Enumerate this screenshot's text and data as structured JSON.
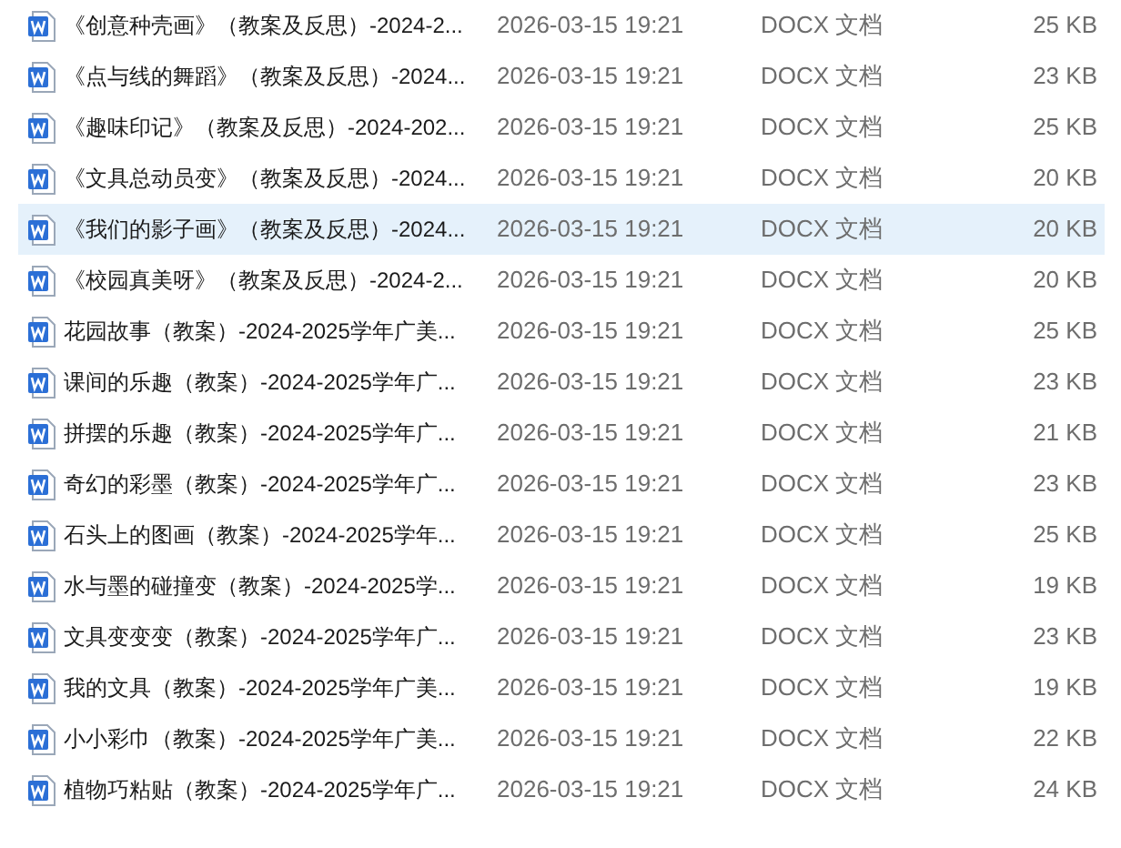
{
  "files": [
    {
      "name": "《创意种壳画》（教案及反思）-2024-2...",
      "modified": "2026-03-15 19:21",
      "type": "DOCX 文档",
      "size": "25 KB",
      "selected": false
    },
    {
      "name": "《点与线的舞蹈》（教案及反思）-2024...",
      "modified": "2026-03-15 19:21",
      "type": "DOCX 文档",
      "size": "23 KB",
      "selected": false
    },
    {
      "name": "《趣味印记》（教案及反思）-2024-202...",
      "modified": "2026-03-15 19:21",
      "type": "DOCX 文档",
      "size": "25 KB",
      "selected": false
    },
    {
      "name": "《文具总动员变》（教案及反思）-2024...",
      "modified": "2026-03-15 19:21",
      "type": "DOCX 文档",
      "size": "20 KB",
      "selected": false
    },
    {
      "name": "《我们的影子画》（教案及反思）-2024...",
      "modified": "2026-03-15 19:21",
      "type": "DOCX 文档",
      "size": "20 KB",
      "selected": true
    },
    {
      "name": "《校园真美呀》（教案及反思）-2024-2...",
      "modified": "2026-03-15 19:21",
      "type": "DOCX 文档",
      "size": "20 KB",
      "selected": false
    },
    {
      "name": "花园故事（教案）-2024-2025学年广美...",
      "modified": "2026-03-15 19:21",
      "type": "DOCX 文档",
      "size": "25 KB",
      "selected": false
    },
    {
      "name": "课间的乐趣（教案）-2024-2025学年广...",
      "modified": "2026-03-15 19:21",
      "type": "DOCX 文档",
      "size": "23 KB",
      "selected": false
    },
    {
      "name": "拼摆的乐趣（教案）-2024-2025学年广...",
      "modified": "2026-03-15 19:21",
      "type": "DOCX 文档",
      "size": "21 KB",
      "selected": false
    },
    {
      "name": "奇幻的彩墨（教案）-2024-2025学年广...",
      "modified": "2026-03-15 19:21",
      "type": "DOCX 文档",
      "size": "23 KB",
      "selected": false
    },
    {
      "name": "石头上的图画（教案）-2024-2025学年...",
      "modified": "2026-03-15 19:21",
      "type": "DOCX 文档",
      "size": "25 KB",
      "selected": false
    },
    {
      "name": "水与墨的碰撞变（教案）-2024-2025学...",
      "modified": "2026-03-15 19:21",
      "type": "DOCX 文档",
      "size": "19 KB",
      "selected": false
    },
    {
      "name": "文具变变变（教案）-2024-2025学年广...",
      "modified": "2026-03-15 19:21",
      "type": "DOCX 文档",
      "size": "23 KB",
      "selected": false
    },
    {
      "name": "我的文具（教案）-2024-2025学年广美...",
      "modified": "2026-03-15 19:21",
      "type": "DOCX 文档",
      "size": "19 KB",
      "selected": false
    },
    {
      "name": "小小彩巾（教案）-2024-2025学年广美...",
      "modified": "2026-03-15 19:21",
      "type": "DOCX 文档",
      "size": "22 KB",
      "selected": false
    },
    {
      "name": "植物巧粘贴（教案）-2024-2025学年广...",
      "modified": "2026-03-15 19:21",
      "type": "DOCX 文档",
      "size": "24 KB",
      "selected": false
    }
  ]
}
